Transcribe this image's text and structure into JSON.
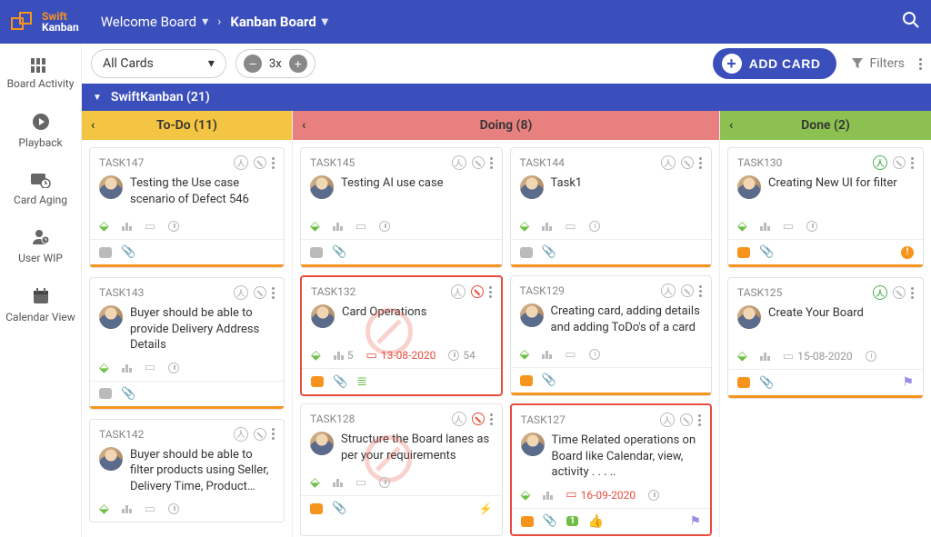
{
  "brand": {
    "line1": "Swift",
    "line2": "Kanban"
  },
  "breadcrumb": {
    "parent": "Welcome Board",
    "current": "Kanban Board"
  },
  "nav": {
    "items": [
      {
        "label": "Board Activity"
      },
      {
        "label": "Playback"
      },
      {
        "label": "Card Aging"
      },
      {
        "label": "User WIP"
      },
      {
        "label": "Calendar View"
      }
    ]
  },
  "toolbar": {
    "filter_dropdown": "All Cards",
    "zoom_level": "3x",
    "add_card_label": "ADD CARD",
    "filters_label": "Filters"
  },
  "lane": {
    "title": "SwiftKanban (21)"
  },
  "columns": {
    "todo": {
      "title": "To-Do (11)"
    },
    "doing": {
      "title": "Doing (8)"
    },
    "done": {
      "title": "Done (2)"
    }
  },
  "cards": {
    "todo": [
      {
        "id": "TASK147",
        "title": "Testing the Use case scenario of Defect 546"
      },
      {
        "id": "TASK143",
        "title": "Buyer should be able to provide Delivery Address Details"
      },
      {
        "id": "TASK142",
        "title": "Buyer should be able to filter products using Seller, Delivery Time, Product…"
      }
    ],
    "doing": [
      {
        "id": "TASK145",
        "title": "Testing AI use case"
      },
      {
        "id": "TASK144",
        "title": "Task1"
      },
      {
        "id": "TASK132",
        "title": "Card Operations",
        "blocked": true,
        "count1": "5",
        "due": "13-08-2020",
        "count2": "54"
      },
      {
        "id": "TASK129",
        "title": "Creating card, adding details and adding ToDo's of a card"
      },
      {
        "id": "TASK128",
        "title": "Structure the Board lanes as per your requirements",
        "blocked_icon": true
      },
      {
        "id": "TASK127",
        "title": "Time Related operations on Board like Calendar, view, activity . . . ..",
        "blocked": true,
        "due": "16-09-2020",
        "thumbs": "1"
      }
    ],
    "done": [
      {
        "id": "TASK130",
        "title": "Creating New UI for filter"
      },
      {
        "id": "TASK125",
        "title": "Create Your Board",
        "due": "15-08-2020"
      }
    ]
  }
}
